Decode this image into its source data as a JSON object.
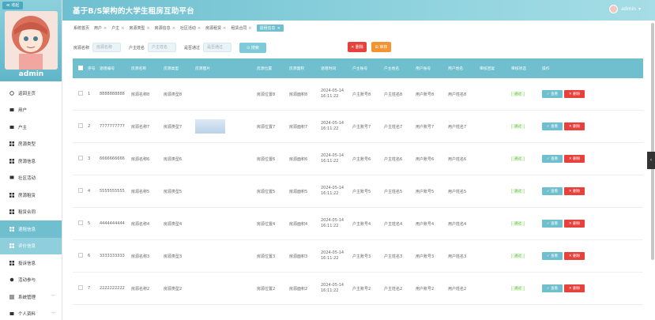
{
  "sidebar": {
    "collapse_label": "≪ 收起",
    "username": "admin",
    "items": [
      {
        "label": "返回主页",
        "icon": "home-icon"
      },
      {
        "label": "用户",
        "icon": "user-icon"
      },
      {
        "label": "户主",
        "icon": "user-icon"
      },
      {
        "label": "房源类型",
        "icon": "grid-icon"
      },
      {
        "label": "房源信息",
        "icon": "grid-icon"
      },
      {
        "label": "社区活动",
        "icon": "grid-icon"
      },
      {
        "label": "房源租赁",
        "icon": "grid-icon"
      },
      {
        "label": "租赁合同",
        "icon": "grid-icon"
      },
      {
        "label": "退租信息",
        "icon": "grid-icon"
      },
      {
        "label": "评价信息",
        "icon": "grid-icon"
      },
      {
        "label": "投诉信息",
        "icon": "grid-icon"
      },
      {
        "label": "活动参与",
        "icon": "grid-icon"
      },
      {
        "label": "系统管理",
        "icon": "gear-icon"
      },
      {
        "label": "个人资料",
        "icon": "user-icon"
      }
    ]
  },
  "header": {
    "title": "基于B/S架构的大学生租房互助平台",
    "user": "admin"
  },
  "tabs": [
    "系统首页",
    "用户",
    "户主",
    "房源类型",
    "房源信息",
    "社区活动",
    "房源租赁",
    "租赁合同",
    "退租信息"
  ],
  "search": {
    "field1_label": "房源名称",
    "field1_placeholder": "房源名称",
    "field2_label": "户主姓名",
    "field2_placeholder": "户主姓名",
    "field3_label": "是否通过",
    "field3_placeholder": "是否通过",
    "search_btn": "⊙ 搜索",
    "delete_btn": "✕ 删除",
    "audit_btn": "⊞ 审核"
  },
  "table": {
    "headers": [
      "",
      "序号",
      "退租编号",
      "房源名称",
      "房源类型",
      "房源图片",
      "房源位置",
      "房源面积",
      "退租时间",
      "户主账号",
      "户主姓名",
      "用户账号",
      "用户姓名",
      "审核回复",
      "审核状态",
      "操作"
    ],
    "view_label": "✓ 查看",
    "delete_label": "✕ 删除",
    "rows": [
      {
        "idx": "1",
        "no": "8888888888",
        "name": "房源名称8",
        "type": "房源类型8",
        "loc": "房源位置8",
        "area": "房源面积8",
        "date": "2024-05-14",
        "time": "16:11:22",
        "owner_acc": "户主账号8",
        "owner_name": "户主姓名8",
        "user_acc": "用户账号8",
        "user_name": "用户姓名8",
        "reply": "",
        "status": "通过",
        "img": false
      },
      {
        "idx": "2",
        "no": "7777777777",
        "name": "房源名称7",
        "type": "房源类型7",
        "loc": "房源位置7",
        "area": "房源面积7",
        "date": "2024-05-14",
        "time": "16:11:22",
        "owner_acc": "户主账号7",
        "owner_name": "户主姓名7",
        "user_acc": "用户账号7",
        "user_name": "用户姓名7",
        "reply": "",
        "status": "通过",
        "img": true
      },
      {
        "idx": "3",
        "no": "6666666666",
        "name": "房源名称6",
        "type": "房源类型6",
        "loc": "房源位置6",
        "area": "房源面积6",
        "date": "2024-05-14",
        "time": "16:11:22",
        "owner_acc": "户主账号6",
        "owner_name": "户主姓名6",
        "user_acc": "用户账号6",
        "user_name": "用户姓名6",
        "reply": "",
        "status": "通过",
        "img": false
      },
      {
        "idx": "4",
        "no": "5555555555",
        "name": "房源名称5",
        "type": "房源类型5",
        "loc": "房源位置5",
        "area": "房源面积5",
        "date": "2024-05-14",
        "time": "16:11:22",
        "owner_acc": "户主账号5",
        "owner_name": "户主姓名5",
        "user_acc": "用户账号5",
        "user_name": "用户姓名5",
        "reply": "",
        "status": "通过",
        "img": false
      },
      {
        "idx": "5",
        "no": "4444444444",
        "name": "房源名称4",
        "type": "房源类型4",
        "loc": "房源位置4",
        "area": "房源面积4",
        "date": "2024-05-14",
        "time": "16:11:22",
        "owner_acc": "户主账号4",
        "owner_name": "户主姓名4",
        "user_acc": "用户账号4",
        "user_name": "用户姓名4",
        "reply": "",
        "status": "通过",
        "img": false
      },
      {
        "idx": "6",
        "no": "3333333333",
        "name": "房源名称3",
        "type": "房源类型3",
        "loc": "房源位置3",
        "area": "房源面积3",
        "date": "2024-05-14",
        "time": "16:11:22",
        "owner_acc": "户主账号3",
        "owner_name": "户主姓名3",
        "user_acc": "用户账号3",
        "user_name": "用户姓名3",
        "reply": "",
        "status": "通过",
        "img": false
      },
      {
        "idx": "7",
        "no": "2222222222",
        "name": "房源名称2",
        "type": "房源类型2",
        "loc": "房源位置2",
        "area": "房源面积2",
        "date": "2024-05-14",
        "time": "16:11:22",
        "owner_acc": "户主账号2",
        "owner_name": "户主姓名2",
        "user_acc": "用户账号2",
        "user_name": "用户姓名2",
        "reply": "",
        "status": "通过",
        "img": false
      }
    ]
  },
  "colors": {
    "accent": "#6fbfcf",
    "danger": "#e8413c",
    "warning": "#f59331",
    "success": "#67c23a"
  }
}
